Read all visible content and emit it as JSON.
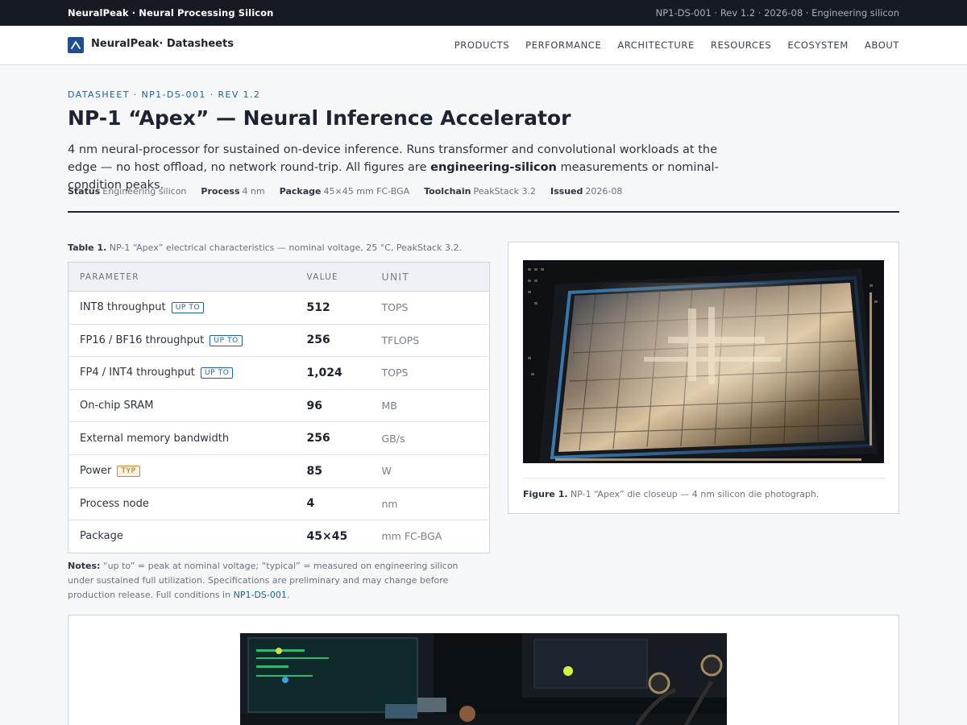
{
  "topbar": {
    "brand": "NeuralPeak · Neural Processing Silicon",
    "meta": "NP1-DS-001 · Rev 1.2 · 2026-08 · Engineering silicon"
  },
  "nav": {
    "logo_text": "NeuralPeak· Datasheets",
    "links": [
      "PRODUCTS",
      "PERFORMANCE",
      "ARCHITECTURE",
      "RESOURCES",
      "ECOSYSTEM",
      "ABOUT"
    ]
  },
  "header": {
    "eyebrow": "DATASHEET · NP1-DS-001 · REV 1.2",
    "title": "NP-1 “Apex” — Neural Inference Accelerator",
    "lede_part1": "4 nm neural-processor for sustained on-device inference. Runs transformer and convolutional workloads at the edge — no host offload, no network round-trip. All figures are ",
    "lede_bold": "engineering-silicon",
    "lede_part2": " measurements or nominal-condition peaks.",
    "facts": [
      {
        "label": "Status",
        "value": "Engineering silicon"
      },
      {
        "label": "Process",
        "value": "4 nm"
      },
      {
        "label": "Package",
        "value": "45×45 mm FC-BGA"
      },
      {
        "label": "Toolchain",
        "value": "PeakStack 3.2"
      },
      {
        "label": "Issued",
        "value": "2026-08"
      }
    ]
  },
  "table": {
    "caption_label": "Table 1.",
    "caption_text": "NP-1 “Apex” electrical characteristics — nominal voltage, 25 °C, PeakStack 3.2.",
    "headers": [
      "PARAMETER",
      "VALUE",
      "UNIT"
    ],
    "rows": [
      {
        "param": "INT8 throughput",
        "badge": "UP TO",
        "value": "512",
        "unit": "TOPS"
      },
      {
        "param": "FP16 / BF16 throughput",
        "badge": "UP TO",
        "value": "256",
        "unit": "TFLOPS"
      },
      {
        "param": "FP4 / INT4 throughput",
        "badge": "UP TO",
        "value": "1,024",
        "unit": "TOPS"
      },
      {
        "param": "On-chip SRAM",
        "value": "96",
        "unit": "MB"
      },
      {
        "param": "External memory bandwidth",
        "value": "256",
        "unit": "GB/s"
      },
      {
        "param": "Power",
        "badge": "TYP",
        "value": "85",
        "unit": "W"
      },
      {
        "param": "Process node",
        "value": "4",
        "unit": "nm"
      },
      {
        "param": "Package",
        "value": "45×45",
        "unit": "mm FC-BGA"
      }
    ]
  },
  "notes": {
    "label": "Notes:",
    "text": " “up to” = peak at nominal voltage; “typical” = measured on engineering silicon under sustained full utilization. Specifications are preliminary and may change before production release. Full conditions in ",
    "link": "NP1-DS-001",
    "end": "."
  },
  "figure1": {
    "label": "Figure 1.",
    "caption": "NP-1 “Apex” die closeup — 4 nm silicon die photograph."
  }
}
